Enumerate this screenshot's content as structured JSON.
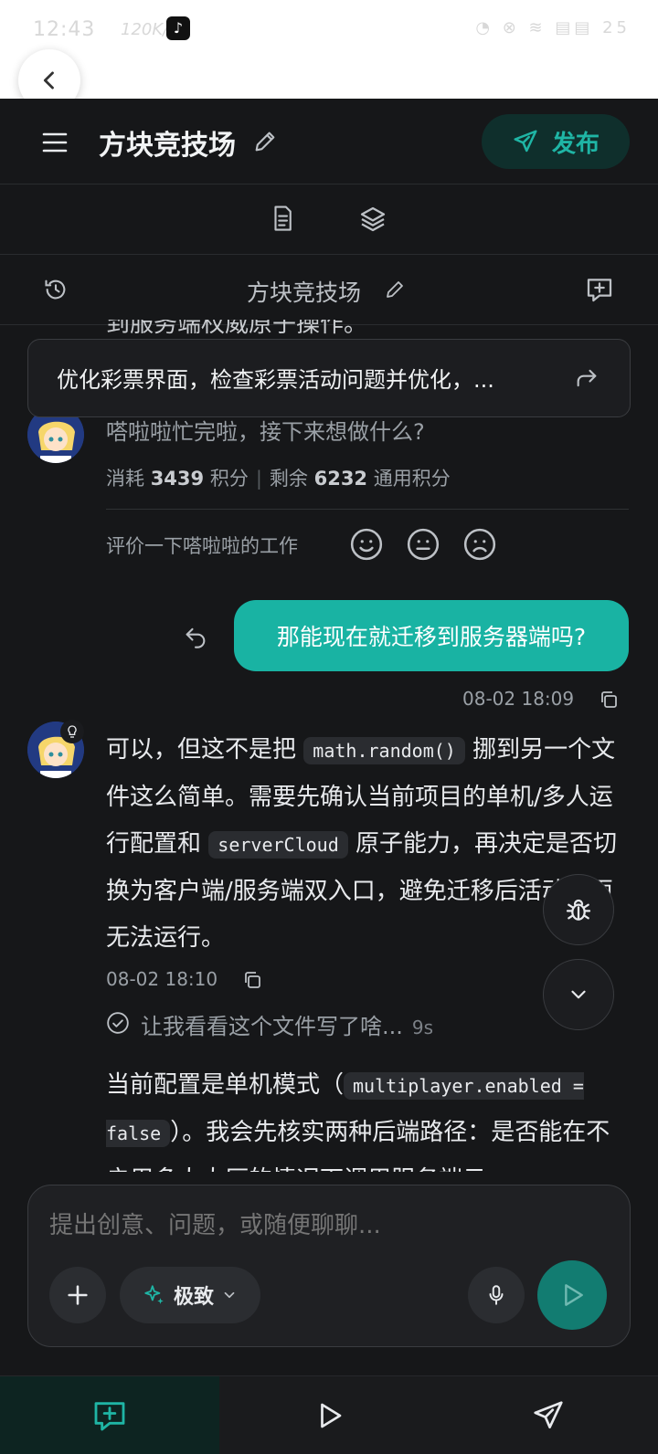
{
  "status": {
    "time": "12:43",
    "speed": "120K/s",
    "right": "◔ ⊗ ≋ ▤▤ 25"
  },
  "header": {
    "title": "方块竞技场",
    "publish_label": "发布"
  },
  "chat": {
    "title": "方块竞技场",
    "clipped_text": "到服务端权威原子操作。",
    "prompt_card": "优化彩票界面，检查彩票活动问题并优化，...",
    "done_text": "嗒啦啦忙完啦，接下来想做什么?",
    "credits": {
      "used_label": "消耗",
      "used_value": "3439",
      "used_unit": "积分",
      "remain_label": "剩余",
      "remain_value": "6232",
      "remain_unit": "通用积分"
    },
    "rate_label": "评价一下嗒啦啦的工作",
    "user_message": "那能现在就迁移到服务器端吗?",
    "user_time": "08-02 18:09",
    "reply": {
      "p1": "可以，但这不是把",
      "code1": "math.random()",
      "p2": "挪到另一个文件这么简单。需要先确认当前项目的单机/多人运行配置和",
      "code2": "serverCloud",
      "p3": "原子能力，再决定是否切换为客户端/服务端双入口，避免迁移后活动页面无法运行。"
    },
    "reply_time": "08-02 18:10",
    "thinking": "让我看看这个文件写了啥...",
    "thinking_time": "9s",
    "reply2": {
      "p1": "当前配置是单机模式（",
      "code1": "multiplayer.enabled = false",
      "p2": "）。我会先核实两种后端路径：是否能在不启用多人大厅的情况下调用服务端云"
    }
  },
  "composer": {
    "placeholder": "提出创意、问题，或随便聊聊...",
    "mode_label": "极致"
  },
  "colors": {
    "accent": "#19b3a3",
    "background": "#161719"
  }
}
